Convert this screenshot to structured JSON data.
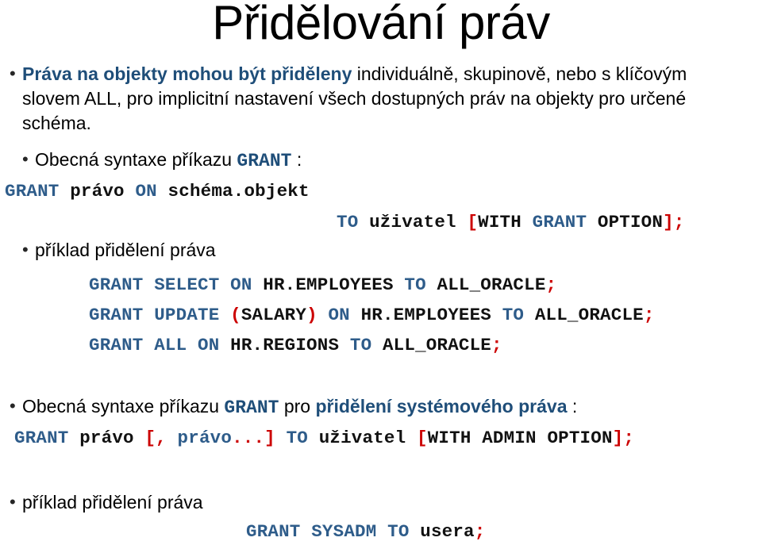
{
  "slide": {
    "title": "Přidělování práv",
    "bullet_glyph": "•",
    "colors": {
      "accent_blue": "#1F4E79",
      "code_blue": "#2E5C8A",
      "code_black": "#111111",
      "code_red": "#CC0000",
      "text_black": "#000000",
      "background": "#ffffff"
    },
    "bullets": [
      {
        "id": "rights-objects",
        "lead_bold": "Práva na objekty mohou být přiděleny",
        "rest": " individuálně, skupinově, nebo s klíčovým slovem ALL, pro implicitní nastavení všech dostupných práv na objekty pro určené schéma."
      },
      {
        "id": "grant-syntax",
        "prefix": "Obecná syntaxe příkazu ",
        "keyword": "GRANT",
        "suffix": " :"
      },
      {
        "id": "example-label-1",
        "text": "příklad přidělení práva"
      },
      {
        "id": "system-grant-syntax",
        "prefix": "Obecná syntaxe příkazu ",
        "keyword": "GRANT",
        "middle": " pro ",
        "emphasis": "přidělení systémového práva",
        "suffix": " :"
      },
      {
        "id": "example-label-2",
        "text": "příklad přidělení práva"
      }
    ],
    "code_lines": [
      {
        "id": "grant-object-syntax-line1",
        "tokens": [
          {
            "t": "GRANT",
            "c": "blue"
          },
          {
            "t": " ",
            "c": "black"
          },
          {
            "t": "právo",
            "c": "black"
          },
          {
            "t": " ",
            "c": "black"
          },
          {
            "t": "ON",
            "c": "blue"
          },
          {
            "t": " ",
            "c": "black"
          },
          {
            "t": "schéma.objekt",
            "c": "black"
          }
        ]
      },
      {
        "id": "grant-object-syntax-line2",
        "tokens": [
          {
            "t": "TO",
            "c": "blue"
          },
          {
            "t": " ",
            "c": "black"
          },
          {
            "t": "uživatel",
            "c": "black"
          },
          {
            "t": " ",
            "c": "black"
          },
          {
            "t": "[",
            "c": "red"
          },
          {
            "t": "WITH",
            "c": "black"
          },
          {
            "t": " ",
            "c": "black"
          },
          {
            "t": "GRANT",
            "c": "blue"
          },
          {
            "t": " ",
            "c": "black"
          },
          {
            "t": "OPTION",
            "c": "black"
          },
          {
            "t": "];",
            "c": "red"
          }
        ]
      },
      {
        "id": "example-grant-select",
        "tokens": [
          {
            "t": "GRANT SELECT ON ",
            "c": "blue"
          },
          {
            "t": "HR.EMPLOYEES",
            "c": "black"
          },
          {
            "t": " ",
            "c": "black"
          },
          {
            "t": "TO",
            "c": "blue"
          },
          {
            "t": " ",
            "c": "black"
          },
          {
            "t": "ALL_ORACLE",
            "c": "black"
          },
          {
            "t": ";",
            "c": "red"
          }
        ]
      },
      {
        "id": "example-grant-update",
        "tokens": [
          {
            "t": "GRANT UPDATE ",
            "c": "blue"
          },
          {
            "t": "(",
            "c": "red"
          },
          {
            "t": "SALARY",
            "c": "black"
          },
          {
            "t": ")",
            "c": "red"
          },
          {
            "t": " ",
            "c": "black"
          },
          {
            "t": "ON",
            "c": "blue"
          },
          {
            "t": " ",
            "c": "black"
          },
          {
            "t": "HR.EMPLOYEES",
            "c": "black"
          },
          {
            "t": " ",
            "c": "black"
          },
          {
            "t": "TO",
            "c": "blue"
          },
          {
            "t": " ",
            "c": "black"
          },
          {
            "t": "ALL_ORACLE",
            "c": "black"
          },
          {
            "t": ";",
            "c": "red"
          }
        ]
      },
      {
        "id": "example-grant-all",
        "tokens": [
          {
            "t": "GRANT ALL ON ",
            "c": "blue"
          },
          {
            "t": "HR.REGIONS",
            "c": "black"
          },
          {
            "t": " ",
            "c": "black"
          },
          {
            "t": "TO",
            "c": "blue"
          },
          {
            "t": " ",
            "c": "black"
          },
          {
            "t": "ALL_ORACLE",
            "c": "black"
          },
          {
            "t": ";",
            "c": "red"
          }
        ]
      },
      {
        "id": "grant-system-syntax",
        "tokens": [
          {
            "t": "GRANT",
            "c": "blue"
          },
          {
            "t": " ",
            "c": "black"
          },
          {
            "t": "právo",
            "c": "black"
          },
          {
            "t": " ",
            "c": "black"
          },
          {
            "t": "[,",
            "c": "red"
          },
          {
            "t": " ",
            "c": "black"
          },
          {
            "t": "právo",
            "c": "blue"
          },
          {
            "t": "...]",
            "c": "red"
          },
          {
            "t": " ",
            "c": "black"
          },
          {
            "t": "TO",
            "c": "blue"
          },
          {
            "t": " ",
            "c": "black"
          },
          {
            "t": "uživatel",
            "c": "black"
          },
          {
            "t": " ",
            "c": "black"
          },
          {
            "t": "[",
            "c": "red"
          },
          {
            "t": "WITH ADMIN OPTION",
            "c": "black"
          },
          {
            "t": "];",
            "c": "red"
          }
        ]
      },
      {
        "id": "example-grant-sysadm",
        "tokens": [
          {
            "t": "GRANT SYSADM TO ",
            "c": "blue"
          },
          {
            "t": "usera",
            "c": "black"
          },
          {
            "t": ";",
            "c": "red"
          }
        ]
      }
    ]
  }
}
